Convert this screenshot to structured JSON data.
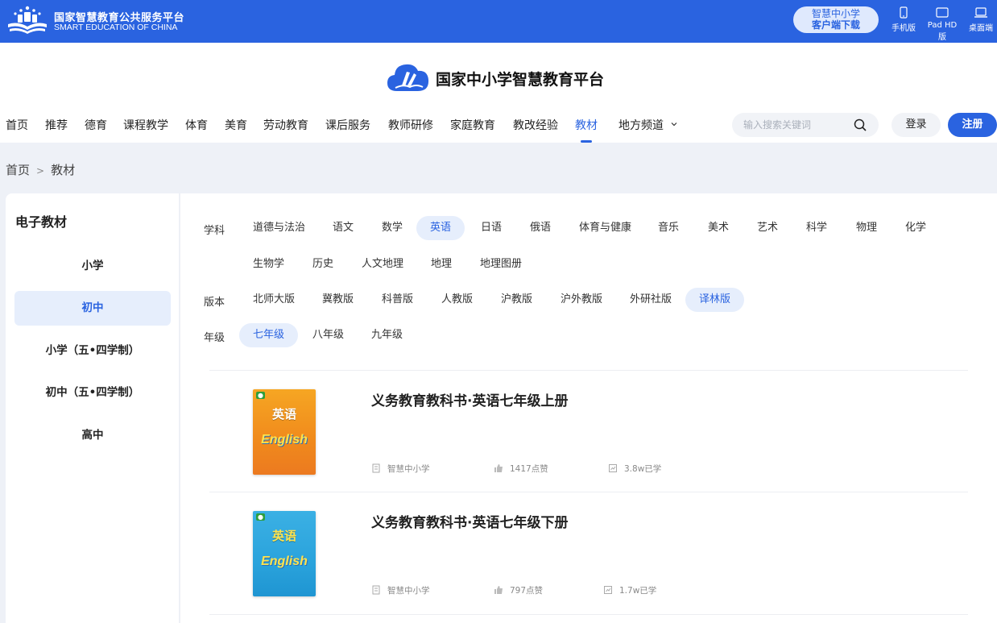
{
  "topbar": {
    "title_cn": "国家智慧教育公共服务平台",
    "title_en": "SMART EDUCATION OF CHINA",
    "download_line1": "智慧中小学",
    "download_line2": "客户端下载",
    "devices": [
      {
        "label": "手机版",
        "icon": "phone-icon"
      },
      {
        "label": "Pad HD版",
        "icon": "tablet-icon"
      },
      {
        "label": "桌面端",
        "icon": "laptop-icon"
      }
    ]
  },
  "brand": {
    "name": "国家中小学智慧教育平台"
  },
  "nav": {
    "items": [
      "首页",
      "推荐",
      "德育",
      "课程教学",
      "体育",
      "美育",
      "劳动教育",
      "课后服务",
      "教师研修",
      "家庭教育",
      "教改经验",
      "教材",
      "地方频道"
    ],
    "active": "教材",
    "search_placeholder": "输入搜索关键词",
    "login": "登录",
    "register": "注册"
  },
  "breadcrumb": {
    "home": "首页",
    "current": "教材"
  },
  "sidebar": {
    "title": "电子教材",
    "items": [
      "小学",
      "初中",
      "小学（五•四学制）",
      "初中（五•四学制）",
      "高中"
    ],
    "active": "初中"
  },
  "filters": {
    "subject_label": "学科",
    "subjects": [
      "道德与法治",
      "语文",
      "数学",
      "英语",
      "日语",
      "俄语",
      "体育与健康",
      "音乐",
      "美术",
      "艺术",
      "科学",
      "物理",
      "化学",
      "生物学",
      "历史",
      "人文地理",
      "地理",
      "地理图册"
    ],
    "subject_active": "英语",
    "edition_label": "版本",
    "editions": [
      "北师大版",
      "冀教版",
      "科普版",
      "人教版",
      "沪教版",
      "沪外教版",
      "外研社版",
      "译林版"
    ],
    "edition_active": "译林版",
    "grade_label": "年级",
    "grades": [
      "七年级",
      "八年级",
      "九年级"
    ],
    "grade_active": "七年级"
  },
  "books": [
    {
      "title": "义务教育教科书·英语七年级上册",
      "cover_title": "英语",
      "cover_en": "English",
      "cover_color": "#f08a1c",
      "publisher": "智慧中小学",
      "likes": "1417点赞",
      "learners": "3.8w已学"
    },
    {
      "title": "义务教育教科书·英语七年级下册",
      "cover_title": "英语",
      "cover_en": "English",
      "cover_color": "#2aa3dc",
      "publisher": "智慧中小学",
      "likes": "797点赞",
      "learners": "1.7w已学"
    }
  ],
  "colors": {
    "primary": "#2a63e0",
    "active_bg": "#e6eefc"
  }
}
